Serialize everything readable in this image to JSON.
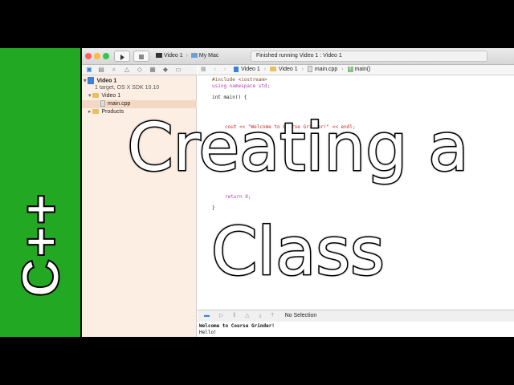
{
  "overlay": {
    "side_label": "C++",
    "title_line1": "Creating a",
    "title_line2": "Class"
  },
  "toolbar": {
    "scheme_target": "Video 1",
    "scheme_device": "My Mac",
    "status": "Finished running Video 1 : Video 1"
  },
  "navigator": {
    "project_name": "Video 1",
    "project_detail": "1 target, OS X SDK 10.10",
    "group": "Video 1",
    "file": "main.cpp",
    "products": "Products"
  },
  "jumpbar": {
    "crumb1": "Video 1",
    "crumb2": "Video 1",
    "crumb3": "main.cpp",
    "crumb4": "main()"
  },
  "code": {
    "line1": "#include <iostream>",
    "line2": "using namespace std;",
    "line3": "int main() {",
    "line4": "cout << \"Welcome to Course Grinder!\" << endl;",
    "line5": "return 0;",
    "line6": "}"
  },
  "debug": {
    "selection": "No Selection"
  },
  "console": {
    "out1": "Welcome to Course Grinder!",
    "out2": "Hello!"
  },
  "colors": {
    "accent_green": "#22a822",
    "selection": "#f3d9c4"
  }
}
